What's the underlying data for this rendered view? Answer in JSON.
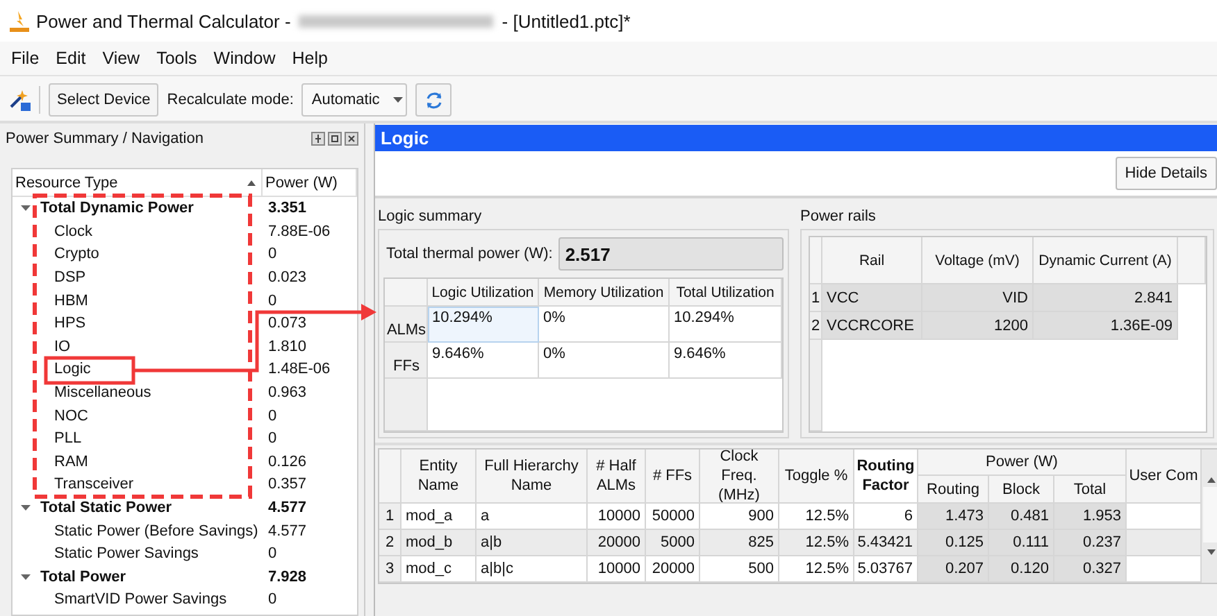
{
  "window": {
    "title_prefix": "Power and Thermal Calculator -",
    "title_suffix": "- [Untitled1.ptc]*"
  },
  "menu": [
    "File",
    "Edit",
    "View",
    "Tools",
    "Window",
    "Help"
  ],
  "toolbar": {
    "select_device": "Select Device",
    "recalc_label": "Recalculate mode:",
    "recalc_value": "Automatic"
  },
  "nav": {
    "title": "Power Summary / Navigation",
    "columns": [
      "Resource Type",
      "Power (W)"
    ],
    "tree": [
      {
        "label": "Total Dynamic Power",
        "value": "3.351",
        "expanded": true,
        "children": [
          {
            "label": "Clock",
            "value": "7.88E-06"
          },
          {
            "label": "Crypto",
            "value": "0"
          },
          {
            "label": "DSP",
            "value": "0.023"
          },
          {
            "label": "HBM",
            "value": "0"
          },
          {
            "label": "HPS",
            "value": "0.073"
          },
          {
            "label": "IO",
            "value": "1.810"
          },
          {
            "label": "Logic",
            "value": "1.48E-06"
          },
          {
            "label": "Miscellaneous",
            "value": "0.963"
          },
          {
            "label": "NOC",
            "value": "0"
          },
          {
            "label": "PLL",
            "value": "0"
          },
          {
            "label": "RAM",
            "value": "0.126"
          },
          {
            "label": "Transceiver",
            "value": "0.357"
          }
        ]
      },
      {
        "label": "Total Static Power",
        "value": "4.577",
        "expanded": true,
        "children": [
          {
            "label": "Static Power (Before Savings)",
            "value": "4.577"
          },
          {
            "label": "Static Power Savings",
            "value": "0"
          }
        ]
      },
      {
        "label": "Total Power",
        "value": "7.928",
        "expanded": true,
        "children": [
          {
            "label": "SmartVID Power Savings",
            "value": "0"
          }
        ]
      }
    ]
  },
  "logic": {
    "title": "Logic",
    "hide_details": "Hide Details",
    "summary": {
      "title": "Logic summary",
      "thermal_label": "Total thermal power (W):",
      "thermal_value": "2.517",
      "columns": [
        "Logic Utilization",
        "Memory Utilization",
        "Total Utilization"
      ],
      "rows": [
        {
          "header": "ALMs",
          "cells": [
            {
              "text": "10.294%",
              "selected": true
            },
            {
              "text": "0%",
              "selected": false
            },
            {
              "text": "10.294%",
              "selected": false
            }
          ]
        },
        {
          "header": "FFs",
          "cells": [
            {
              "text": "9.646%",
              "selected": false
            },
            {
              "text": "0%",
              "selected": false
            },
            {
              "text": "9.646%",
              "selected": false
            }
          ]
        }
      ]
    },
    "rails": {
      "title": "Power rails",
      "columns": [
        "Rail",
        "Voltage (mV)",
        "Dynamic Current (A)"
      ],
      "rows": [
        {
          "index": "1",
          "cells": [
            "VCC",
            "VID",
            "2.841"
          ]
        },
        {
          "index": "2",
          "cells": [
            "VCCRCORE",
            "1200",
            "1.36E-09"
          ]
        }
      ]
    },
    "entities": {
      "columns": [
        {
          "label": "Entity Name",
          "kind": "text"
        },
        {
          "label": "Full Hierarchy Name",
          "kind": "text"
        },
        {
          "label": "# Half ALMs",
          "kind": "number"
        },
        {
          "label": "# FFs",
          "kind": "number"
        },
        {
          "label": "Clock Freq. (MHz)",
          "kind": "number"
        },
        {
          "label": "Toggle %",
          "kind": "number"
        },
        {
          "label": "Routing Factor",
          "kind": "factor"
        },
        {
          "label": "Power (W)",
          "kind": "group",
          "sub": [
            "Routing",
            "Block",
            "Total"
          ]
        },
        {
          "label": "User Com",
          "kind": "text"
        }
      ],
      "rows": [
        {
          "index": "1",
          "cells": [
            "mod_a",
            "a",
            "10000",
            "50000",
            "900",
            "12.5%",
            "6",
            "1.473",
            "0.481",
            "1.953"
          ]
        },
        {
          "index": "2",
          "cells": [
            "mod_b",
            "a|b",
            "20000",
            "5000",
            "825",
            "12.5%",
            "5.43421",
            "0.125",
            "0.111",
            "0.237"
          ]
        },
        {
          "index": "3",
          "cells": [
            "mod_c",
            "a|b|c",
            "10000",
            "20000",
            "500",
            "12.5%",
            "5.03767",
            "0.207",
            "0.120",
            "0.327"
          ]
        }
      ]
    }
  },
  "annotations": [
    {
      "kind": "dashed_frame"
    },
    {
      "kind": "box"
    },
    {
      "kind": "arrow"
    }
  ]
}
